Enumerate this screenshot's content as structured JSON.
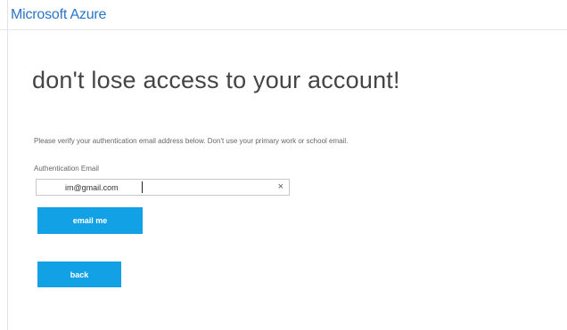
{
  "header": {
    "brand": "Microsoft Azure"
  },
  "main": {
    "heading": "don't lose access to your account!",
    "instructions": "Please verify your authentication email address below. Don't use your primary work or school email.",
    "email_label": "Authentication Email",
    "email_value": "im@gmail.com",
    "clear_glyph": "×",
    "email_me_label": "email me",
    "back_label": "back"
  },
  "colors": {
    "brand": "#2b74c7",
    "button": "#13a1e6"
  }
}
